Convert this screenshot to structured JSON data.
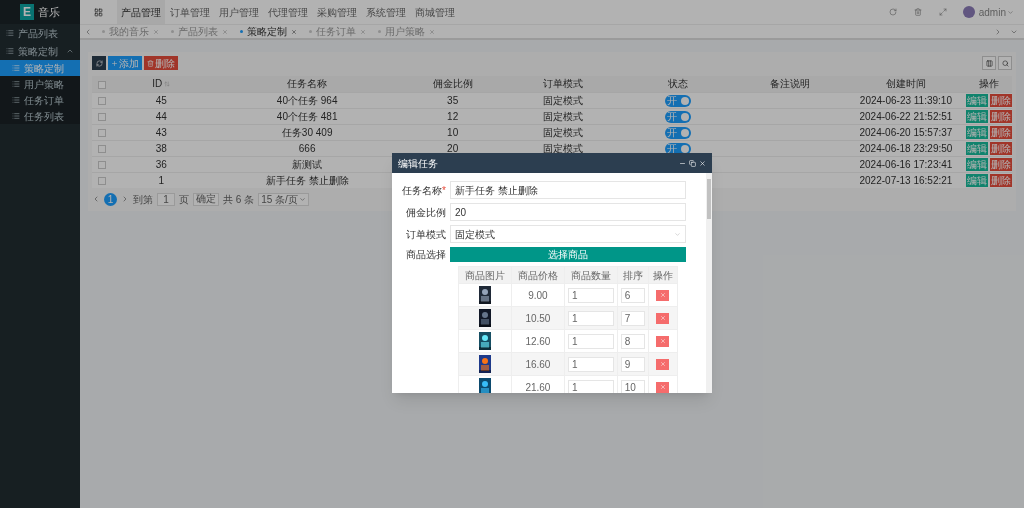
{
  "sidebar": {
    "logo": "E",
    "title": "音乐",
    "items": [
      {
        "kind": "link",
        "label": "产品列表",
        "selected": false
      },
      {
        "kind": "group",
        "label": "策略定制",
        "selected": false,
        "expanded": true,
        "children": [
          {
            "label": "策略定制",
            "selected": true
          },
          {
            "label": "用户策略",
            "selected": false
          },
          {
            "label": "任务订单",
            "selected": false
          },
          {
            "label": "任务列表",
            "selected": false
          }
        ]
      }
    ]
  },
  "header": {
    "nav": [
      {
        "label": "产品管理",
        "selected": true
      },
      {
        "label": "订单管理",
        "selected": false
      },
      {
        "label": "用户管理",
        "selected": false
      },
      {
        "label": "代理管理",
        "selected": false
      },
      {
        "label": "采购管理",
        "selected": false
      },
      {
        "label": "系统管理",
        "selected": false
      },
      {
        "label": "商城管理",
        "selected": false
      }
    ],
    "user": "admin"
  },
  "tabs": [
    {
      "label": "我的音乐",
      "selected": false
    },
    {
      "label": "产品列表",
      "selected": false
    },
    {
      "label": "策略定制",
      "selected": true
    },
    {
      "label": "任务订单",
      "selected": false
    },
    {
      "label": "用户策略",
      "selected": false
    }
  ],
  "toolbar": {
    "add": "添加",
    "delete": "删除"
  },
  "table": {
    "select_all": {
      "checked": false
    },
    "columns": [
      {
        "label": "ID",
        "sortable": true
      },
      {
        "label": "任务名称",
        "sortable": false
      },
      {
        "label": "佣金比例",
        "sortable": false
      },
      {
        "label": "订单模式",
        "sortable": false
      },
      {
        "label": "状态",
        "sortable": false
      },
      {
        "label": "备注说明",
        "sortable": false
      },
      {
        "label": "创建时间",
        "sortable": false
      },
      {
        "label": "操作",
        "sortable": false
      }
    ],
    "rows": [
      {
        "checked": false,
        "id": "45",
        "name": "40个任务 964",
        "rate": "35",
        "mode": "固定模式",
        "status": {
          "label": "开",
          "on": true
        },
        "created": "2024-06-23 11:39:10",
        "edit": "编辑",
        "delete": "删除"
      },
      {
        "checked": false,
        "id": "44",
        "name": "40个任务 481",
        "rate": "12",
        "mode": "固定模式",
        "status": {
          "label": "开",
          "on": true
        },
        "created": "2024-06-22 21:52:51",
        "edit": "编辑",
        "delete": "删除"
      },
      {
        "checked": false,
        "id": "43",
        "name": "任务30 409",
        "rate": "10",
        "mode": "固定模式",
        "status": {
          "label": "开",
          "on": true
        },
        "created": "2024-06-20 15:57:37",
        "edit": "编辑",
        "delete": "删除"
      },
      {
        "checked": false,
        "id": "38",
        "name": "666",
        "rate": "20",
        "mode": "固定模式",
        "status": {
          "label": "开",
          "on": true
        },
        "created": "2024-06-18 23:29:50",
        "edit": "编辑",
        "delete": "删除"
      },
      {
        "checked": false,
        "id": "36",
        "name": "新测试",
        "created": "2024-06-16 17:23:41",
        "edit": "编辑",
        "delete": "删除"
      },
      {
        "checked": false,
        "id": "1",
        "name": "新手任务 禁止删除",
        "created": "2022-07-13 16:52:21",
        "edit": "编辑",
        "delete": "删除"
      }
    ]
  },
  "pagination": {
    "current": "1",
    "goto": "到第",
    "page": "1",
    "page_unit": "页",
    "confirm": "确定",
    "total": "共 6 条",
    "page_size": "15 条/页"
  },
  "modal": {
    "title": "编辑任务",
    "required_mark": "*",
    "fields": [
      {
        "kind": "input",
        "label": "任务名称",
        "required": true,
        "value": "新手任务 禁止删除"
      },
      {
        "kind": "input",
        "label": "佣金比例",
        "required": false,
        "value": "20"
      },
      {
        "kind": "select",
        "label": "订单模式",
        "required": false,
        "value": "固定模式"
      },
      {
        "kind": "products",
        "label": "商品选择",
        "required": false,
        "button": "选择商品"
      }
    ],
    "product_columns": [
      "商品图片",
      "商品价格",
      "商品数量",
      "排序",
      "操作"
    ],
    "products": [
      {
        "price": "9.00",
        "quantity": "1",
        "sort": "6"
      },
      {
        "price": "10.50",
        "quantity": "1",
        "sort": "7"
      },
      {
        "price": "12.60",
        "quantity": "1",
        "sort": "8"
      },
      {
        "price": "16.60",
        "quantity": "1",
        "sort": "9"
      },
      {
        "price": "21.60",
        "quantity": "1",
        "sort": "10"
      }
    ]
  }
}
